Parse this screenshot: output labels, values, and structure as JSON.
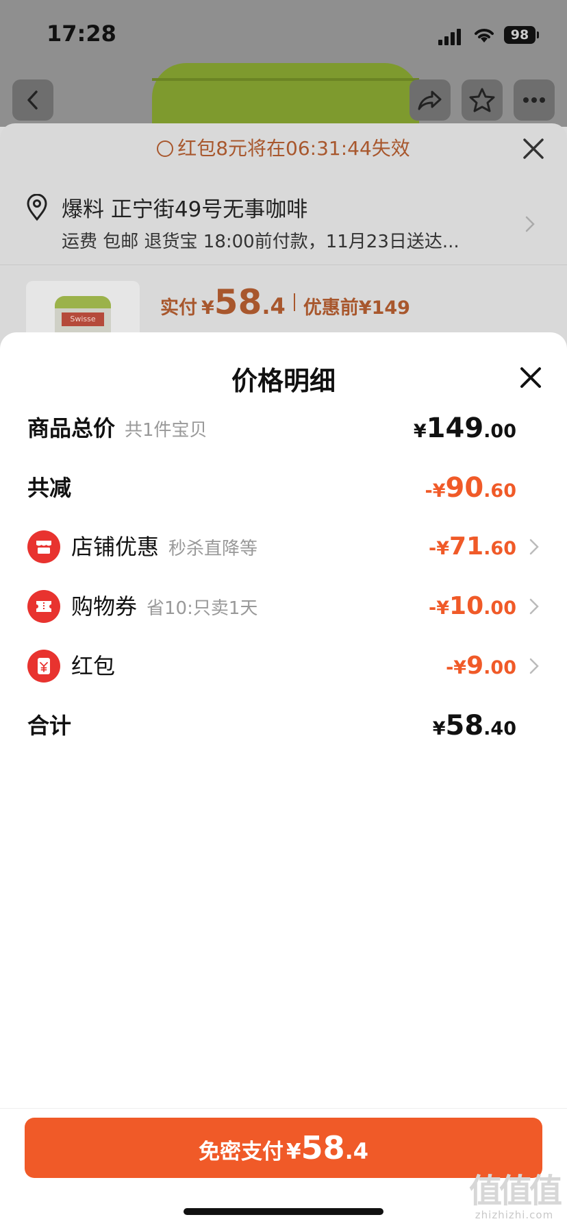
{
  "status_bar": {
    "time": "17:28",
    "battery": "98"
  },
  "background": {
    "timer_text": "红包8元将在06:31:44失效",
    "address": "爆料 正宁街49号无事咖啡",
    "shipping": "运费 包邮 退货宝 18:00前付款，11月23日送达...",
    "product_label": "Swisse",
    "price_label": "实付",
    "price_yen": "¥",
    "price_int": "58",
    "price_dec": ".4",
    "price_before": "优惠前¥149"
  },
  "sheet": {
    "title": "价格明细",
    "total_goods": {
      "label": "商品总价",
      "sub": "共1件宝贝",
      "yen": "¥",
      "int": "149",
      "dec": ".00"
    },
    "total_reduce": {
      "label": "共减",
      "yen": "-¥",
      "int": "90",
      "dec": ".60"
    },
    "discounts": [
      {
        "label": "店铺优惠",
        "sub": "秒杀直降等",
        "yen": "-¥",
        "int": "71",
        "dec": ".60",
        "icon": "shop-icon"
      },
      {
        "label": "购物券",
        "sub": "省10:只卖1天",
        "yen": "-¥",
        "int": "10",
        "dec": ".00",
        "icon": "coupon-icon"
      },
      {
        "label": "红包",
        "sub": "",
        "yen": "-¥",
        "int": "9",
        "dec": ".00",
        "icon": "red-packet-icon"
      }
    ],
    "sum": {
      "label": "合计",
      "yen": "¥",
      "int": "58",
      "dec": ".40"
    }
  },
  "pay_button": {
    "label": "免密支付",
    "yen": "¥",
    "int": "58",
    "dec": ".4"
  },
  "watermark": {
    "main": "值值值",
    "sub": "zhizhizhi.com"
  },
  "colors": {
    "accent": "#f05a28",
    "icon_red": "#e8332f",
    "sub_text": "#999999"
  }
}
